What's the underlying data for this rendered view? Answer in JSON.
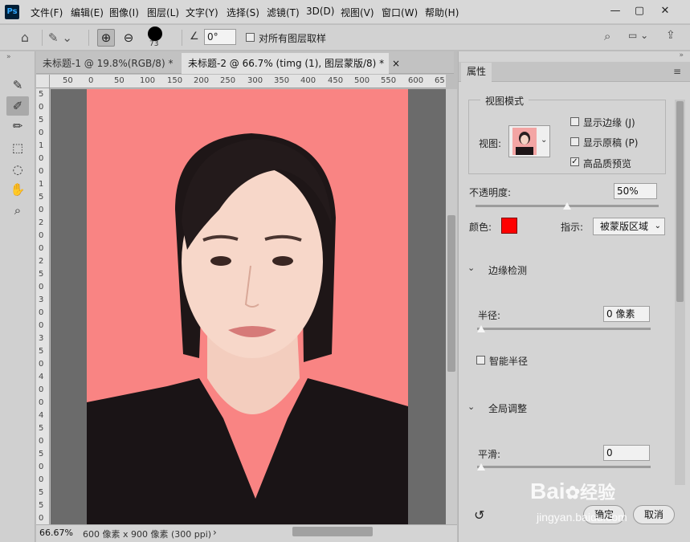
{
  "app": {
    "logo": "Ps"
  },
  "menu": [
    "文件(F)",
    "编辑(E)",
    "图像(I)",
    "图层(L)",
    "文字(Y)",
    "选择(S)",
    "滤镜(T)",
    "3D(D)",
    "视图(V)",
    "窗口(W)",
    "帮助(H)"
  ],
  "options_bar": {
    "brush_size": "73",
    "angle": "0°",
    "sample_all_layers": "对所有图层取样"
  },
  "tabs": [
    {
      "label": "未标题-1 @ 19.8%(RGB/8) *",
      "close": "×"
    },
    {
      "label": "未标题-2 @ 66.7% (timg (1), 图层蒙版/8) *",
      "close": "×"
    }
  ],
  "rulers": {
    "horizontal": [
      "50",
      "0",
      "50",
      "100",
      "150",
      "200",
      "250",
      "300",
      "350",
      "400",
      "450",
      "500",
      "550",
      "600",
      "65"
    ],
    "vertical": [
      "5",
      "0",
      "5",
      "0",
      "1",
      "0",
      "0",
      "1",
      "5",
      "0",
      "2",
      "0",
      "0",
      "2",
      "5",
      "0",
      "3",
      "0",
      "0",
      "3",
      "5",
      "0",
      "4",
      "0",
      "0",
      "4",
      "5",
      "0",
      "5",
      "0",
      "0",
      "5",
      "5",
      "0"
    ]
  },
  "status": {
    "zoom": "66.67%",
    "doc_info": "600 像素 x 900 像素 (300 ppi)",
    "arrow": "›"
  },
  "panel": {
    "tab": "属性",
    "view_mode": {
      "title": "视图模式",
      "view_label": "视图:",
      "show_edge": "显示边缘 (J)",
      "show_original": "显示原稿 (P)",
      "high_quality": "高品质预览",
      "show_edge_checked": false,
      "show_original_checked": false,
      "high_quality_checked": true
    },
    "opacity": {
      "label": "不透明度:",
      "value": "50%",
      "fraction": 0.5
    },
    "color": {
      "label": "颜色:",
      "swatch": "#ff0000"
    },
    "indicate": {
      "label": "指示:",
      "value": "被蒙版区域"
    },
    "edge_detection": {
      "title": "边缘检测",
      "radius_label": "半径:",
      "radius_value": "0 像素",
      "radius_fraction": 0,
      "smart_radius": "智能半径",
      "smart_radius_checked": false
    },
    "global": {
      "title": "全局调整",
      "smooth_label": "平滑:",
      "smooth_value": "0",
      "smooth_fraction": 0
    },
    "buttons": {
      "ok": "确定",
      "cancel": "取消"
    }
  },
  "watermark": {
    "brand": "Bai",
    "brand2": "经验",
    "url": "jingyan.baidu.com"
  },
  "colors": {
    "canvas_bg": "#f98483",
    "accent_blue": "#31a8ff"
  }
}
